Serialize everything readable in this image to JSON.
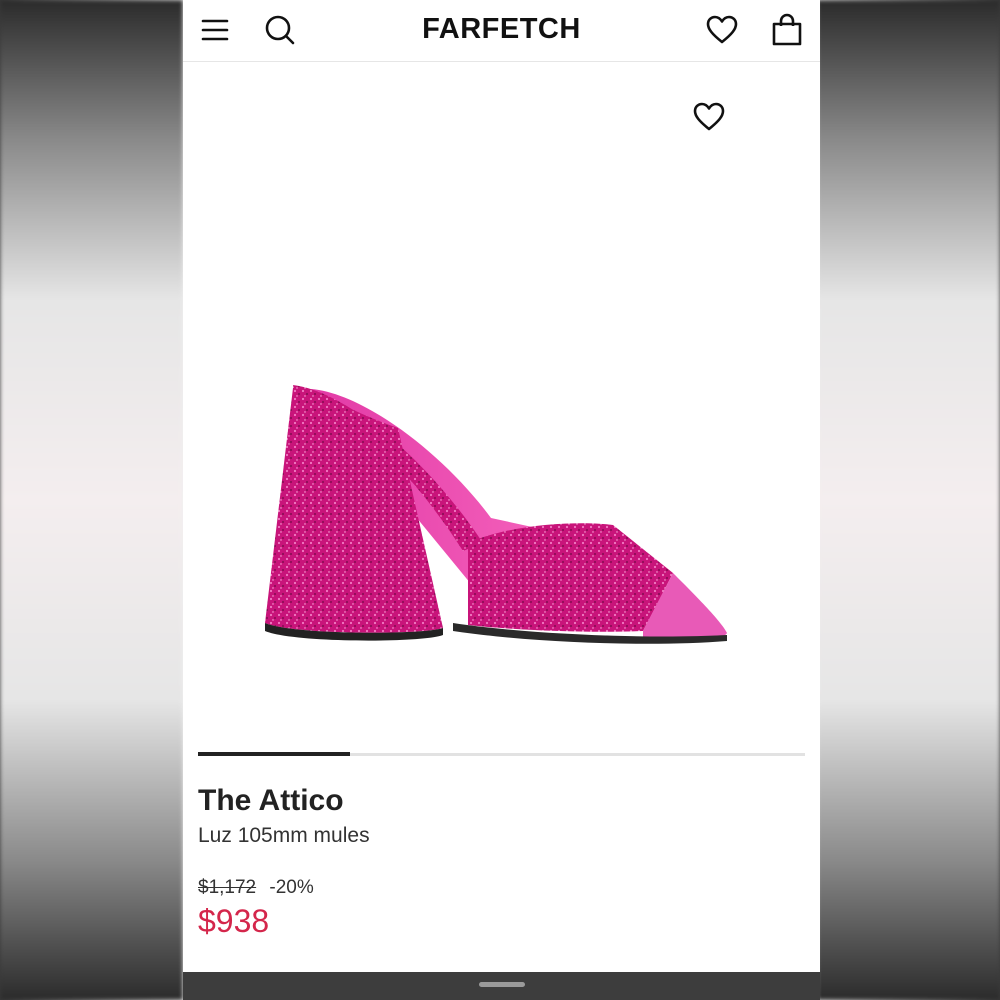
{
  "header": {
    "brand": "FARFETCH",
    "icons": [
      "menu-icon",
      "search-icon",
      "wishlist-icon",
      "bag-icon"
    ]
  },
  "gallery": {
    "image_progress": 0.25,
    "image_icon": "heart-outline-icon"
  },
  "product": {
    "brand": "The Attico",
    "name": "Luz 105mm mules",
    "original_price": "$1,172",
    "discount": "-20%",
    "sale_price": "$938"
  },
  "colors": {
    "sale_price": "#d4264b",
    "shoe": "#c8147a"
  }
}
